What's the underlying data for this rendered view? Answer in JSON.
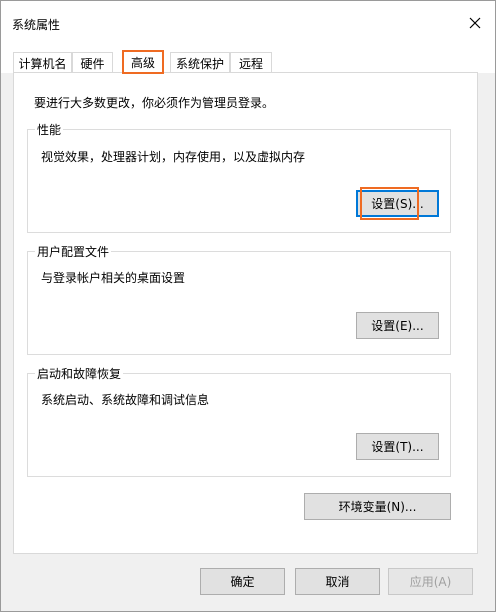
{
  "window": {
    "title": "系统属性"
  },
  "tabs": [
    {
      "label": "计算机名"
    },
    {
      "label": "硬件"
    },
    {
      "label": "高级",
      "active": true
    },
    {
      "label": "系统保护"
    },
    {
      "label": "远程"
    }
  ],
  "notice": "要进行大多数更改，你必须作为管理员登录。",
  "performance": {
    "label": "性能",
    "description": "视觉效果，处理器计划，内存使用，以及虚拟内存",
    "button": "设置(S)..."
  },
  "user_profiles": {
    "label": "用户配置文件",
    "description": "与登录帐户相关的桌面设置",
    "button": "设置(E)..."
  },
  "startup_recovery": {
    "label": "启动和故障恢复",
    "description": "系统启动、系统故障和调试信息",
    "button": "设置(T)..."
  },
  "env_button": "环境变量(N)...",
  "footer": {
    "ok": "确定",
    "cancel": "取消",
    "apply": "应用(A)"
  },
  "colors": {
    "highlight": "#ef6b22",
    "focus_blue": "#0078d7"
  },
  "icons": {
    "close": "close-icon"
  }
}
